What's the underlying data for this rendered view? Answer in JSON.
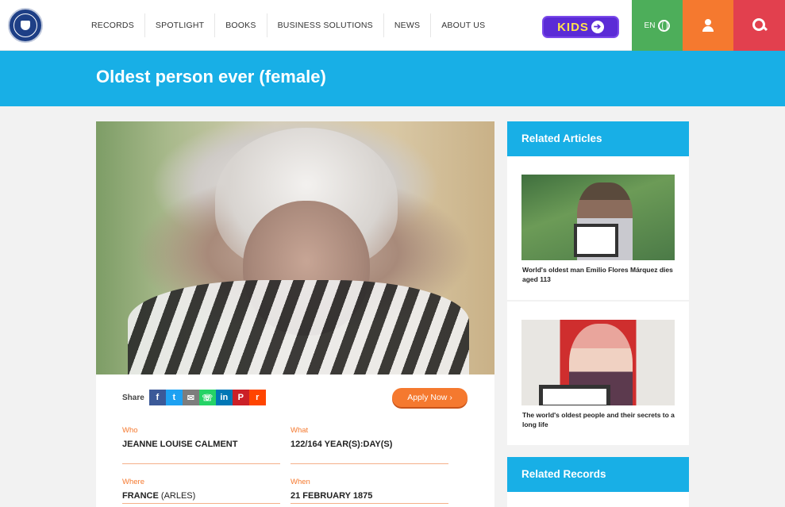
{
  "header": {
    "nav": [
      "RECORDS",
      "SPOTLIGHT",
      "BOOKS",
      "BUSINESS SOLUTIONS",
      "NEWS",
      "ABOUT US"
    ],
    "kids_label": "KIDS",
    "language": "EN"
  },
  "page": {
    "title": "Oldest person ever (female)"
  },
  "share": {
    "label": "Share",
    "networks": [
      "facebook",
      "twitter",
      "email",
      "whatsapp",
      "linkedin",
      "pinterest",
      "reddit"
    ],
    "apply_label": "Apply Now"
  },
  "details": {
    "who_label": "Who",
    "who_value": "JEANNE LOUISE CALMENT",
    "what_label": "What",
    "what_value": "122/164 YEAR(S):DAY(S)",
    "where_label": "Where",
    "where_value": "FRANCE",
    "where_extra": "(ARLES)",
    "when_label": "When",
    "when_value": "21 FEBRUARY 1875"
  },
  "sidebar": {
    "related_articles_title": "Related Articles",
    "articles": [
      {
        "caption": "World's oldest man Emilio Flores Márquez dies aged 113"
      },
      {
        "caption": "The world's oldest people and their secrets to a long life"
      }
    ],
    "related_records_title": "Related Records"
  },
  "colors": {
    "brand_blue": "#18afe6",
    "accent_orange": "#f5792f",
    "lang_green": "#4dae5a",
    "search_red": "#e2404e"
  }
}
